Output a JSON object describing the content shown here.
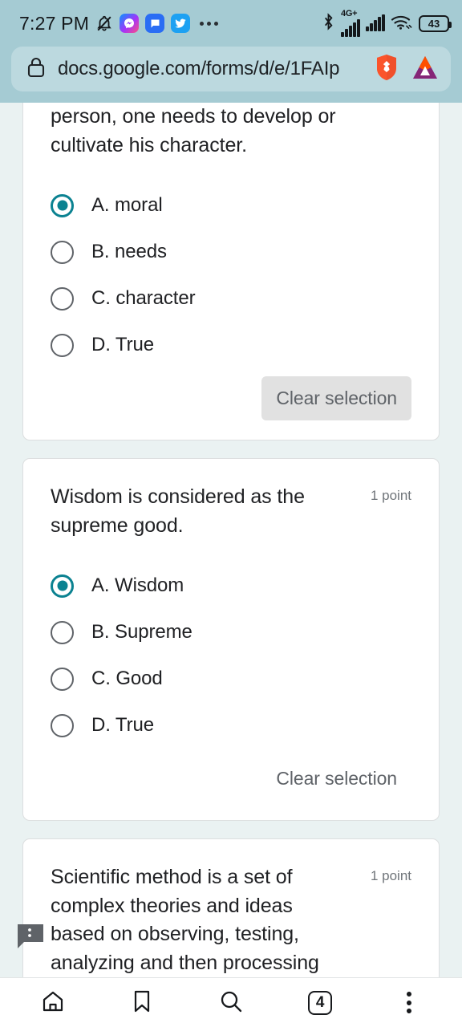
{
  "status_bar": {
    "time": "7:27 PM",
    "notification_icons": [
      "bell-muted-icon",
      "messenger-icon",
      "google-messages-icon",
      "twitter-icon",
      "more-notifications-icon"
    ],
    "network_label": "4G+",
    "battery_level": "43",
    "right_icons": [
      "bluetooth-icon",
      "cellular-signal-1-icon",
      "cellular-signal-2-icon",
      "wifi-icon",
      "battery-icon"
    ]
  },
  "browser": {
    "url": "docs.google.com/forms/d/e/1FAIp",
    "lock_icon": "lock-icon",
    "shield_icon": "brave-shield-icon",
    "rewards_icon": "bat-rewards-icon"
  },
  "form": {
    "questions": [
      {
        "text": "person, one needs to develop or cultivate his character.",
        "points": "",
        "truncated_top": true,
        "options": [
          {
            "label": "A. moral",
            "selected": true
          },
          {
            "label": "B. needs",
            "selected": false
          },
          {
            "label": "C. character",
            "selected": false
          },
          {
            "label": "D. True",
            "selected": false
          }
        ],
        "clear_label": "Clear selection",
        "clear_pressed": true
      },
      {
        "text": "Wisdom is considered as the supreme good.",
        "points": "1 point",
        "truncated_top": false,
        "options": [
          {
            "label": "A. Wisdom",
            "selected": true
          },
          {
            "label": "B. Supreme",
            "selected": false
          },
          {
            "label": "C. Good",
            "selected": false
          },
          {
            "label": "D. True",
            "selected": false
          }
        ],
        "clear_label": "Clear selection",
        "clear_pressed": false
      },
      {
        "text": "Scientific method is a set of complex theories and ideas based on observing, testing, analyzing and then processing phenomena.",
        "points": "1 point",
        "truncated_top": false,
        "options": [],
        "clear_label": "",
        "clear_pressed": false
      }
    ],
    "report_icon": "report-feedback-icon"
  },
  "bottom_nav": {
    "items": [
      {
        "name": "home-icon",
        "label": ""
      },
      {
        "name": "bookmarks-icon",
        "label": ""
      },
      {
        "name": "search-icon",
        "label": ""
      },
      {
        "name": "tab-switcher",
        "label": "4"
      },
      {
        "name": "more-menu-icon",
        "label": ""
      }
    ]
  },
  "colors": {
    "chrome_teal": "#a5cbd3",
    "urlbar_bg": "#bcd9df",
    "page_bg": "#eaf2f2",
    "accent_teal": "#0b8291",
    "card_white": "#ffffff",
    "muted_text": "#70757a",
    "pressed_gray": "#e1e1e1"
  }
}
